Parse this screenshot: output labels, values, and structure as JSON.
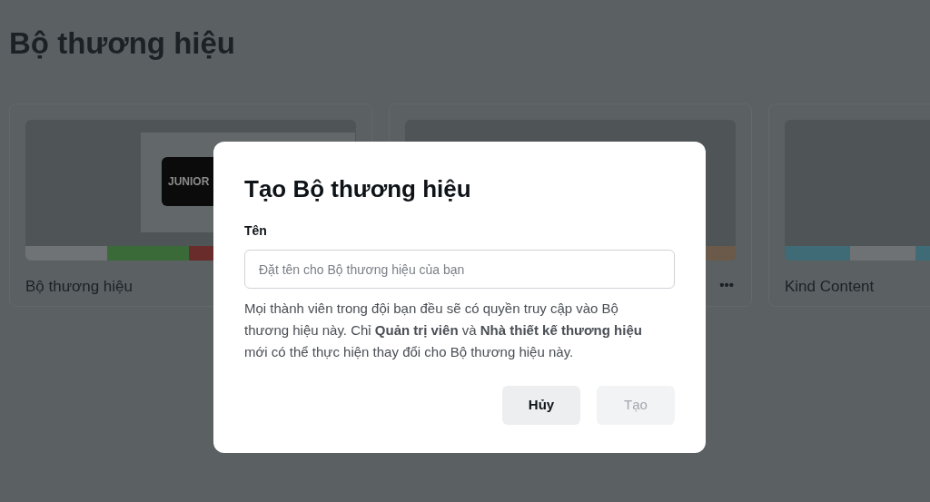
{
  "page": {
    "title": "Bộ thương hiệu"
  },
  "brand_kits": [
    {
      "name": "Bộ thương hiệu",
      "logo_text": "JUNIOR",
      "swatches": [
        {
          "color": "#6f7375"
        },
        {
          "color": "#3b6a39"
        },
        {
          "color": "#6a2b2b"
        }
      ]
    },
    {
      "menu": "•••",
      "swatches": [
        {
          "color": "#6b5a49"
        }
      ]
    },
    {
      "name": "Kind Content",
      "swatches": [
        {
          "color": "#3e6b75"
        },
        {
          "color": "#6e7274"
        },
        {
          "color": "#3e6b75"
        }
      ]
    }
  ],
  "dialog": {
    "title": "Tạo Bộ thương hiệu",
    "field_label": "Tên",
    "placeholder": "Đặt tên cho Bộ thương hiệu của bạn",
    "description": "Mọi thành viên trong đội bạn đều sẽ có quyền truy cập vào Bộ thương hiệu này. Chỉ **Quản trị viên** và **Nhà thiết kế thương hiệu** mới có thể thực hiện thay đổi cho Bộ thương hiệu này.",
    "buttons": [
      {
        "label": "Hủy",
        "disabled": false
      },
      {
        "label": "Tạo",
        "disabled": true
      }
    ]
  }
}
